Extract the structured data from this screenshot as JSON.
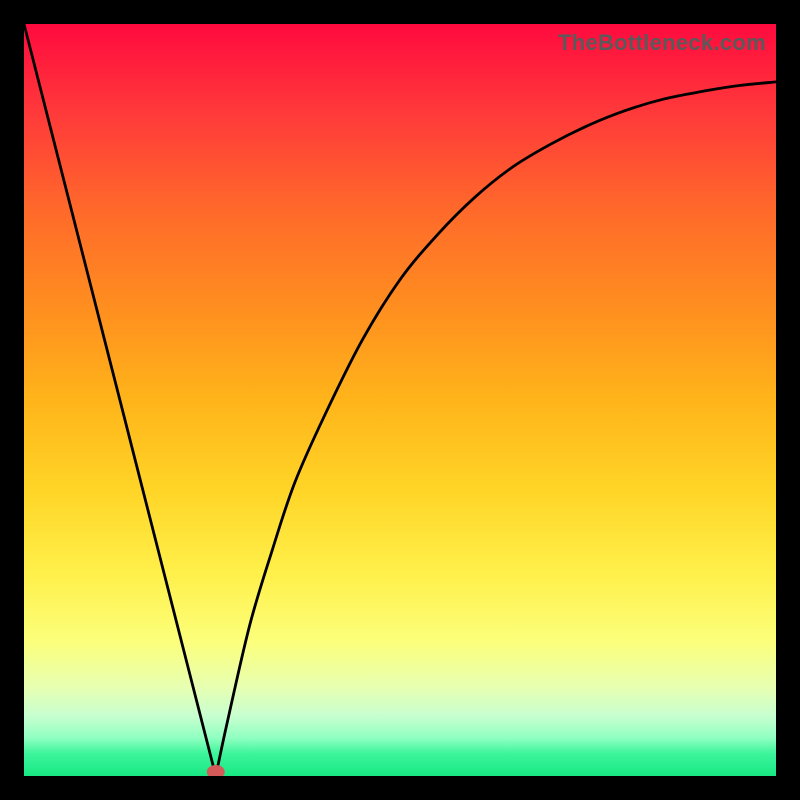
{
  "source_label": "TheBottleneck.com",
  "chart_data": {
    "type": "line",
    "title": "",
    "xlabel": "",
    "ylabel": "",
    "xlim": [
      0,
      100
    ],
    "ylim": [
      0,
      100
    ],
    "grid": false,
    "series": [
      {
        "name": "bottleneck-curve",
        "x": [
          0,
          5,
          10,
          15,
          18,
          20,
          22,
          24,
          25.5,
          27,
          30,
          33,
          36,
          40,
          45,
          50,
          55,
          60,
          65,
          70,
          75,
          80,
          85,
          90,
          95,
          100
        ],
        "values": [
          100,
          81,
          62,
          42,
          30,
          22,
          14,
          6,
          0,
          7,
          20,
          30,
          39,
          48,
          58,
          66,
          72,
          77,
          81,
          84,
          86.5,
          88.5,
          90,
          91,
          91.8,
          92.3
        ]
      }
    ],
    "marker": {
      "x": 25.5,
      "y": 0,
      "color": "#d45a5a"
    },
    "background_gradient": [
      "#ff0a3e",
      "#ff3a3a",
      "#ff6a2a",
      "#ff8f1f",
      "#ffb41a",
      "#ffd527",
      "#fff04a",
      "#fcff7a",
      "#e8ffb0",
      "#c8ffd0",
      "#8effc0",
      "#3df59b",
      "#18e884"
    ]
  }
}
